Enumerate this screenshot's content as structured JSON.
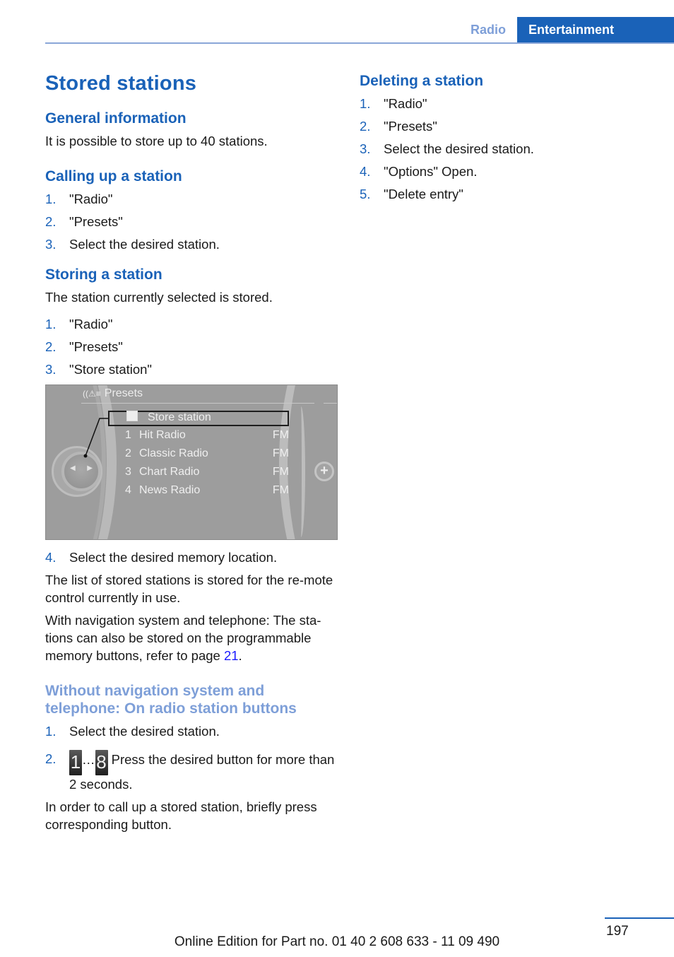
{
  "header": {
    "tabs": [
      {
        "label": "Radio",
        "active": false
      },
      {
        "label": "Entertainment",
        "active": true
      }
    ]
  },
  "colors": {
    "accent": "#1a62b8",
    "accent_light": "#7e9fd8",
    "link": "#1a1aff",
    "text": "#1a1a1a"
  },
  "page_title": "Stored stations",
  "sections": {
    "general": {
      "heading": "General information",
      "text": "It is possible to store up to 40 stations."
    },
    "calling": {
      "heading": "Calling up a station",
      "steps": [
        {
          "num": "1.",
          "text": "\"Radio\""
        },
        {
          "num": "2.",
          "text": "\"Presets\""
        },
        {
          "num": "3.",
          "text": "Select the desired station."
        }
      ]
    },
    "storing": {
      "heading": "Storing a station",
      "intro": "The station currently selected is stored.",
      "steps": [
        {
          "num": "1.",
          "text": "\"Radio\""
        },
        {
          "num": "2.",
          "text": "\"Presets\""
        },
        {
          "num": "3.",
          "text": "\"Store station\""
        }
      ],
      "step4": {
        "num": "4.",
        "text": "Select the desired memory location."
      },
      "para1": "The list of stored stations is stored for the re-mote control currently in use.",
      "para2_prefix": "With navigation system and telephone: The sta-tions can also be stored on the programmable memory buttons, refer to page ",
      "para2_link": "21",
      "para2_suffix": "."
    },
    "without_nav": {
      "heading": "Without navigation system and telephone: On radio station buttons",
      "step1": {
        "num": "1.",
        "text": "Select the desired station."
      },
      "step2": {
        "num": "2.",
        "key_first": "1",
        "ellipsis": "…",
        "key_last": "8",
        "text": " Press the desired button for more than 2 seconds."
      },
      "closing": "In order to call up a stored station, briefly press corresponding button."
    },
    "deleting": {
      "heading": "Deleting a station",
      "steps": [
        {
          "num": "1.",
          "text": "\"Radio\""
        },
        {
          "num": "2.",
          "text": "\"Presets\""
        },
        {
          "num": "3.",
          "text": "Select the desired station."
        },
        {
          "num": "4.",
          "text": "\"Options\" Open."
        },
        {
          "num": "5.",
          "text": "\"Delete entry\""
        }
      ]
    }
  },
  "screen": {
    "title": "Presets",
    "title_icon": "radio-list-icon",
    "selected_item": {
      "icon": "store-icon",
      "label": "Store station"
    },
    "presets": [
      {
        "num": "1",
        "name": "Hit Radio",
        "band": "FM"
      },
      {
        "num": "2",
        "name": "Classic Radio",
        "band": "FM"
      },
      {
        "num": "3",
        "name": "Chart Radio",
        "band": "FM"
      },
      {
        "num": "4",
        "name": "News Radio",
        "band": "FM"
      }
    ],
    "plus_symbol": "+",
    "arrow_left": "◀",
    "arrow_right": "▶"
  },
  "footer": {
    "page_number": "197",
    "edition": "Online Edition for Part no. 01 40 2 608 633 - 11 09 490"
  }
}
